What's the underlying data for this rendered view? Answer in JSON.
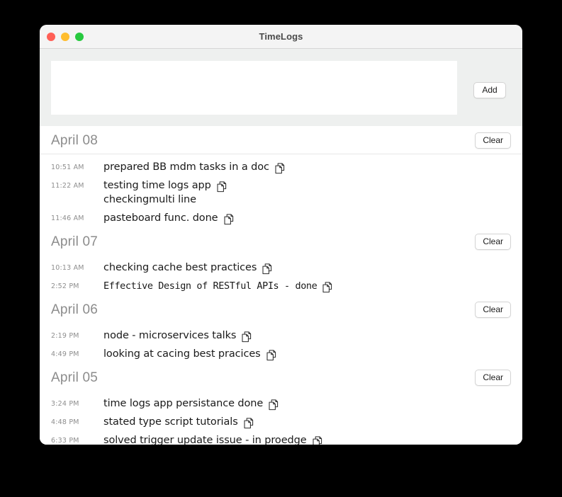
{
  "window": {
    "title": "TimeLogs",
    "traffic_lights": [
      {
        "name": "close-button",
        "color": "#ff5f56"
      },
      {
        "name": "minimize-button",
        "color": "#ffbd2e"
      },
      {
        "name": "maximize-button",
        "color": "#27c93f"
      }
    ]
  },
  "compose": {
    "input_value": "",
    "input_placeholder": "",
    "add_label": "Add"
  },
  "common": {
    "clear_label": "Clear",
    "copy_icon": "copy-icon"
  },
  "days": [
    {
      "date": "April 08",
      "clear_label": "Clear",
      "entries": [
        {
          "time": "10:51 AM",
          "text": "prepared BB mdm tasks in a doc",
          "mono": false
        },
        {
          "time": "11:22 AM",
          "text": "testing time logs app\ncheckingmulti line",
          "mono": false
        },
        {
          "time": "11:46 AM",
          "text": "pasteboard func. done",
          "mono": false
        }
      ]
    },
    {
      "date": "April 07",
      "clear_label": "Clear",
      "entries": [
        {
          "time": "10:13 AM",
          "text": "checking cache best practices",
          "mono": false
        },
        {
          "time": "2:52 PM",
          "text": "Effective Design of RESTful APIs - done",
          "mono": true
        }
      ]
    },
    {
      "date": "April 06",
      "clear_label": "Clear",
      "entries": [
        {
          "time": "2:19 PM",
          "text": "node - microservices talks",
          "mono": false
        },
        {
          "time": "4:49 PM",
          "text": "looking at cacing best pracices",
          "mono": false
        }
      ]
    },
    {
      "date": "April 05",
      "clear_label": "Clear",
      "entries": [
        {
          "time": "3:24 PM",
          "text": "time logs app persistance done",
          "mono": false
        },
        {
          "time": "4:48 PM",
          "text": "stated type script tutorials",
          "mono": false
        },
        {
          "time": "6:33 PM",
          "text": "solved trigger update issue  - in proedge",
          "mono": false
        }
      ]
    }
  ]
}
